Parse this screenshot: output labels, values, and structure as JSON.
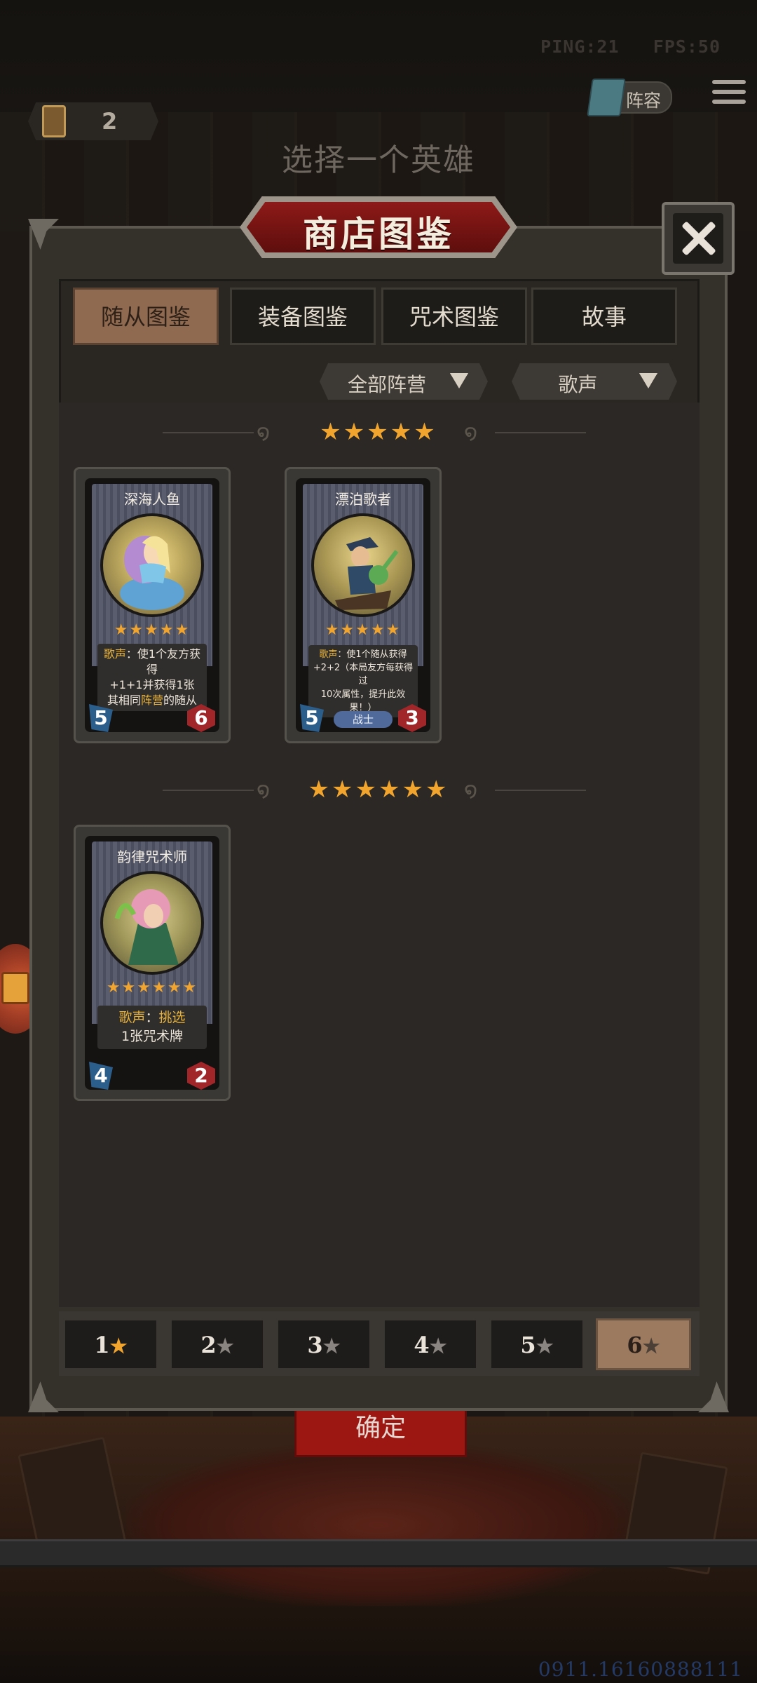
{
  "status_bar": {
    "ping": "PING:21",
    "fps": "FPS:50"
  },
  "top_right": {
    "roster_label": "阵容",
    "menu_icon": "hamburger-menu-icon"
  },
  "currency": {
    "count": "2",
    "icon": "card-pack-icon"
  },
  "screen_title": "选择一个英雄",
  "panel": {
    "title": "商店图鉴",
    "close_icon": "close-x-icon"
  },
  "tabs": [
    {
      "label": "随从图鉴",
      "active": true
    },
    {
      "label": "装备图鉴",
      "active": false
    },
    {
      "label": "咒术图鉴",
      "active": false
    },
    {
      "label": "故事",
      "active": false
    }
  ],
  "filters": {
    "faction": "全部阵营",
    "keyword": "歌声"
  },
  "tiers": [
    {
      "stars": "★★★★★",
      "cards": [
        {
          "name": "深海人鱼",
          "stars": "★★★★★",
          "desc_kw": "歌声",
          "desc_1": "：使1个友方获得",
          "desc_2": "+1+1并获得1张",
          "desc_3a": "其相同",
          "desc_3kw": "阵营",
          "desc_3b": "的随从",
          "attack": "5",
          "health": "6"
        },
        {
          "name": "漂泊歌者",
          "stars": "★★★★★",
          "desc_kw": "歌声",
          "desc_1": "：使1个随从获得",
          "desc_2": "+2+2（本局友方每获得过",
          "desc_3": "10次属性，提升此效果！）",
          "tribe": "战士",
          "attack": "5",
          "health": "3"
        }
      ]
    },
    {
      "stars": "★★★★★★",
      "cards": [
        {
          "name": "韵律咒术师",
          "stars": "★★★★★★",
          "desc_kw": "歌声",
          "desc_1": "：",
          "desc_kw2": "挑选",
          "desc_2": "1张咒术牌",
          "attack": "4",
          "health": "2"
        }
      ]
    }
  ],
  "star_filter": [
    {
      "num": "1",
      "star": "★"
    },
    {
      "num": "2",
      "star": "★"
    },
    {
      "num": "3",
      "star": "★"
    },
    {
      "num": "4",
      "star": "★"
    },
    {
      "num": "5",
      "star": "★"
    },
    {
      "num": "6",
      "star": "★"
    }
  ],
  "confirm_label": "确定",
  "watermark": "0911.16160888111",
  "colors": {
    "accent_gold": "#f1a52e",
    "title_red": "#8d1a18",
    "active_tab": "#8f6a50"
  }
}
